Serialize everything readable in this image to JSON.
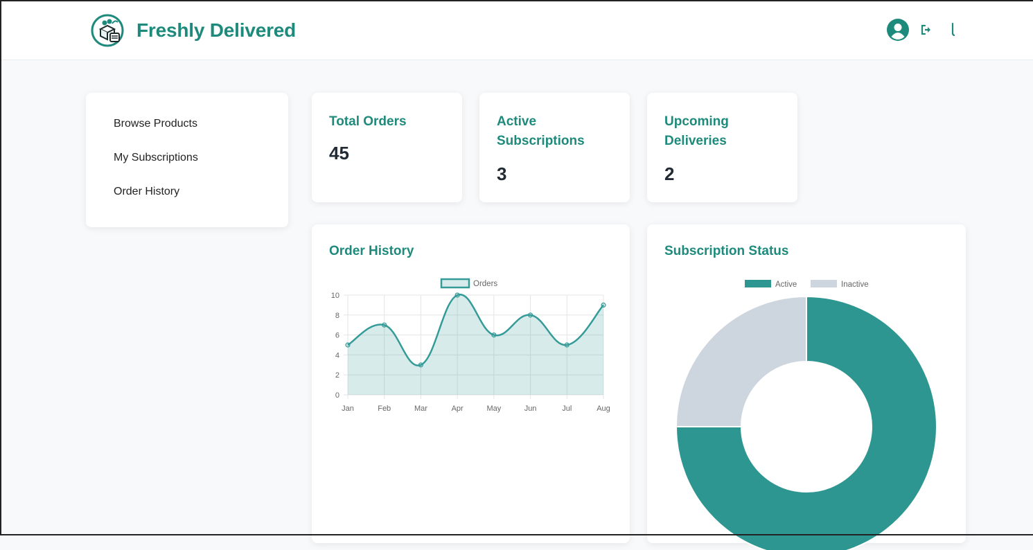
{
  "app": {
    "brand": "Freshly Delivered",
    "accent_color": "#1e8a7c",
    "logo_icon": "produce-box-calendar-icon"
  },
  "header": {
    "icons": [
      "user-circle-icon",
      "sign-out-icon",
      "phone-icon"
    ]
  },
  "sidebar": {
    "items": [
      {
        "label": "Browse Products"
      },
      {
        "label": "My Subscriptions"
      },
      {
        "label": "Order History"
      }
    ]
  },
  "stats": [
    {
      "title": "Total Orders",
      "value": "45"
    },
    {
      "title": "Active Subscriptions",
      "value": "3"
    },
    {
      "title": "Upcoming Deliveries",
      "value": "2"
    }
  ],
  "charts": {
    "order_history_title": "Order History",
    "subscription_status_title": "Subscription Status"
  },
  "chart_data": [
    {
      "type": "line",
      "title": "Order History",
      "categories": [
        "Jan",
        "Feb",
        "Mar",
        "Apr",
        "May",
        "Jun",
        "Jul",
        "Aug"
      ],
      "series": [
        {
          "name": "Orders",
          "values": [
            5,
            7,
            3,
            10,
            6,
            8,
            5,
            9
          ],
          "color": "#349b98",
          "fill": "rgba(52,155,152,0.2)"
        }
      ],
      "yticks": [
        "0",
        "2",
        "4",
        "6",
        "8",
        "10"
      ],
      "ylim": [
        0,
        10
      ],
      "grid": true,
      "legend": "top-center",
      "smooth": true,
      "area": true
    },
    {
      "type": "pie",
      "donut": true,
      "title": "Subscription Status",
      "labels": [
        "Active",
        "Inactive"
      ],
      "values": [
        3,
        1
      ],
      "colors": [
        "#2e9690",
        "#cdd6df"
      ],
      "legend": "top-center"
    }
  ]
}
